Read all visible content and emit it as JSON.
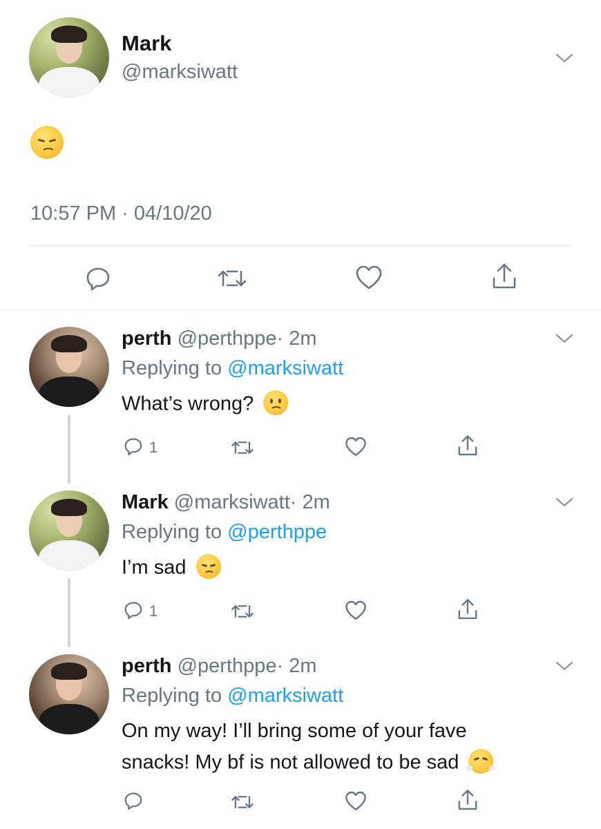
{
  "main_tweet": {
    "display_name": "Mark",
    "handle": "@marksiwatt",
    "emoji": "pensive-face",
    "timestamp": "10:57 PM · 04/10/20"
  },
  "replies": [
    {
      "display_name": "perth",
      "handle": "@perthppe",
      "time": "· 2m",
      "replying_prefix": "Replying to",
      "replying_to": "@marksiwatt",
      "text": "What’s wrong?",
      "emoji": "slightly-frowning-face",
      "reply_count": "1"
    },
    {
      "display_name": "Mark",
      "handle": "@marksiwatt",
      "time": "· 2m",
      "replying_prefix": "Replying to",
      "replying_to": "@perthppe",
      "text": "I’m sad",
      "emoji": "pensive-face",
      "reply_count": "1"
    },
    {
      "display_name": "perth",
      "handle": "@perthppe",
      "time": "· 2m",
      "replying_prefix": "Replying to",
      "replying_to": "@marksiwatt",
      "text_line1": "On my way! I’ll bring some of your fave",
      "text_line2": "snacks! My bf is not allowed to be sad",
      "emoji": "face-with-steam-from-nose",
      "reply_count": ""
    }
  ],
  "colors": {
    "link": "#1da1f2",
    "secondary_text": "#657786",
    "divider": "#e1e8ed",
    "thread_line": "#ccd6dd"
  }
}
